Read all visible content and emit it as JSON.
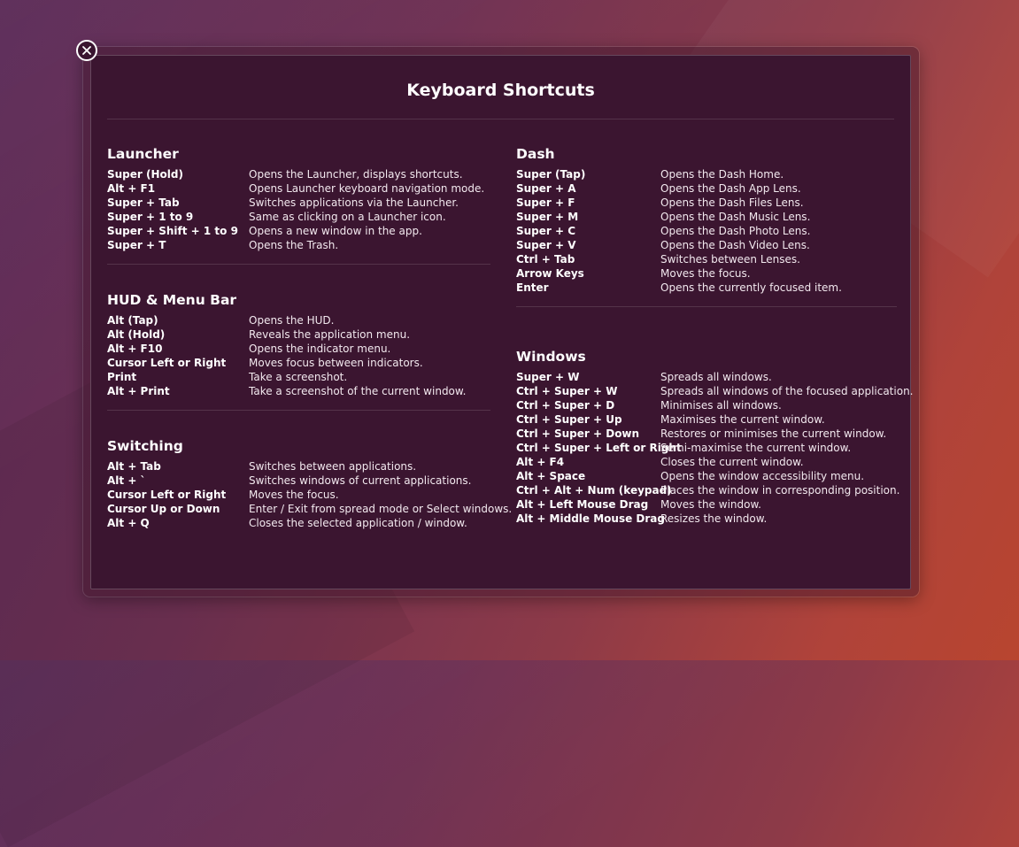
{
  "title": "Keyboard Shortcuts",
  "close_icon": "close-circle-icon",
  "colors": {
    "panel": "#3b1530",
    "text": "#ffffff"
  },
  "left_column": [
    {
      "title": "Launcher",
      "shortcuts": [
        {
          "key": "Super (Hold)",
          "desc": "Opens the Launcher, displays shortcuts."
        },
        {
          "key": "Alt + F1",
          "desc": "Opens Launcher keyboard navigation mode."
        },
        {
          "key": "Super + Tab",
          "desc": "Switches applications via the Launcher."
        },
        {
          "key": "Super + 1 to 9",
          "desc": "Same as clicking on a Launcher icon."
        },
        {
          "key": "Super + Shift + 1 to 9",
          "desc": "Opens a new window in the app."
        },
        {
          "key": "Super + T",
          "desc": "Opens the Trash."
        }
      ]
    },
    {
      "title": "HUD & Menu Bar",
      "shortcuts": [
        {
          "key": "Alt (Tap)",
          "desc": "Opens the HUD."
        },
        {
          "key": "Alt (Hold)",
          "desc": "Reveals the application menu."
        },
        {
          "key": "Alt + F10",
          "desc": "Opens the indicator menu."
        },
        {
          "key": "Cursor Left or Right",
          "desc": "Moves focus between indicators."
        },
        {
          "key": "Print",
          "desc": "Take a screenshot."
        },
        {
          "key": "Alt + Print",
          "desc": "Take a screenshot of the current window."
        }
      ]
    },
    {
      "title": "Switching",
      "shortcuts": [
        {
          "key": "Alt + Tab",
          "desc": "Switches between applications."
        },
        {
          "key": "Alt + `",
          "desc": "Switches windows of current applications."
        },
        {
          "key": "Cursor Left or Right",
          "desc": "Moves the focus."
        },
        {
          "key": "Cursor Up or Down",
          "desc": "Enter / Exit from spread mode or Select windows."
        },
        {
          "key": "Alt + Q",
          "desc": "Closes the selected application / window."
        }
      ]
    }
  ],
  "right_column": [
    {
      "title": "Dash",
      "shortcuts": [
        {
          "key": "Super (Tap)",
          "desc": "Opens the Dash Home."
        },
        {
          "key": "Super + A",
          "desc": "Opens the Dash App Lens."
        },
        {
          "key": "Super + F",
          "desc": "Opens the Dash Files Lens."
        },
        {
          "key": "Super + M",
          "desc": "Opens the Dash Music Lens."
        },
        {
          "key": "Super + C",
          "desc": "Opens the Dash Photo Lens."
        },
        {
          "key": "Super + V",
          "desc": "Opens the Dash Video Lens."
        },
        {
          "key": "Ctrl + Tab",
          "desc": "Switches between Lenses."
        },
        {
          "key": "Arrow Keys",
          "desc": "Moves the focus."
        },
        {
          "key": "Enter",
          "desc": "Opens the currently focused item."
        }
      ]
    },
    {
      "title": "Windows",
      "shortcuts": [
        {
          "key": "Super + W",
          "desc": "Spreads all windows."
        },
        {
          "key": "Ctrl + Super + W",
          "desc": "Spreads all windows of the focused application."
        },
        {
          "key": "Ctrl + Super + D",
          "desc": "Minimises all windows."
        },
        {
          "key": "Ctrl + Super + Up",
          "desc": "Maximises the current window."
        },
        {
          "key": "Ctrl + Super + Down",
          "desc": "Restores or minimises the current window."
        },
        {
          "key": "Ctrl + Super + Left or Right",
          "desc": "Semi-maximise the current window."
        },
        {
          "key": "Alt + F4",
          "desc": "Closes the current window."
        },
        {
          "key": "Alt + Space",
          "desc": "Opens the window accessibility menu."
        },
        {
          "key": "Ctrl + Alt + Num (keypad)",
          "desc": "Places the window in corresponding position."
        },
        {
          "key": "Alt + Left Mouse Drag",
          "desc": "Moves the window."
        },
        {
          "key": "Alt + Middle Mouse Drag",
          "desc": "Resizes the window."
        }
      ]
    }
  ]
}
